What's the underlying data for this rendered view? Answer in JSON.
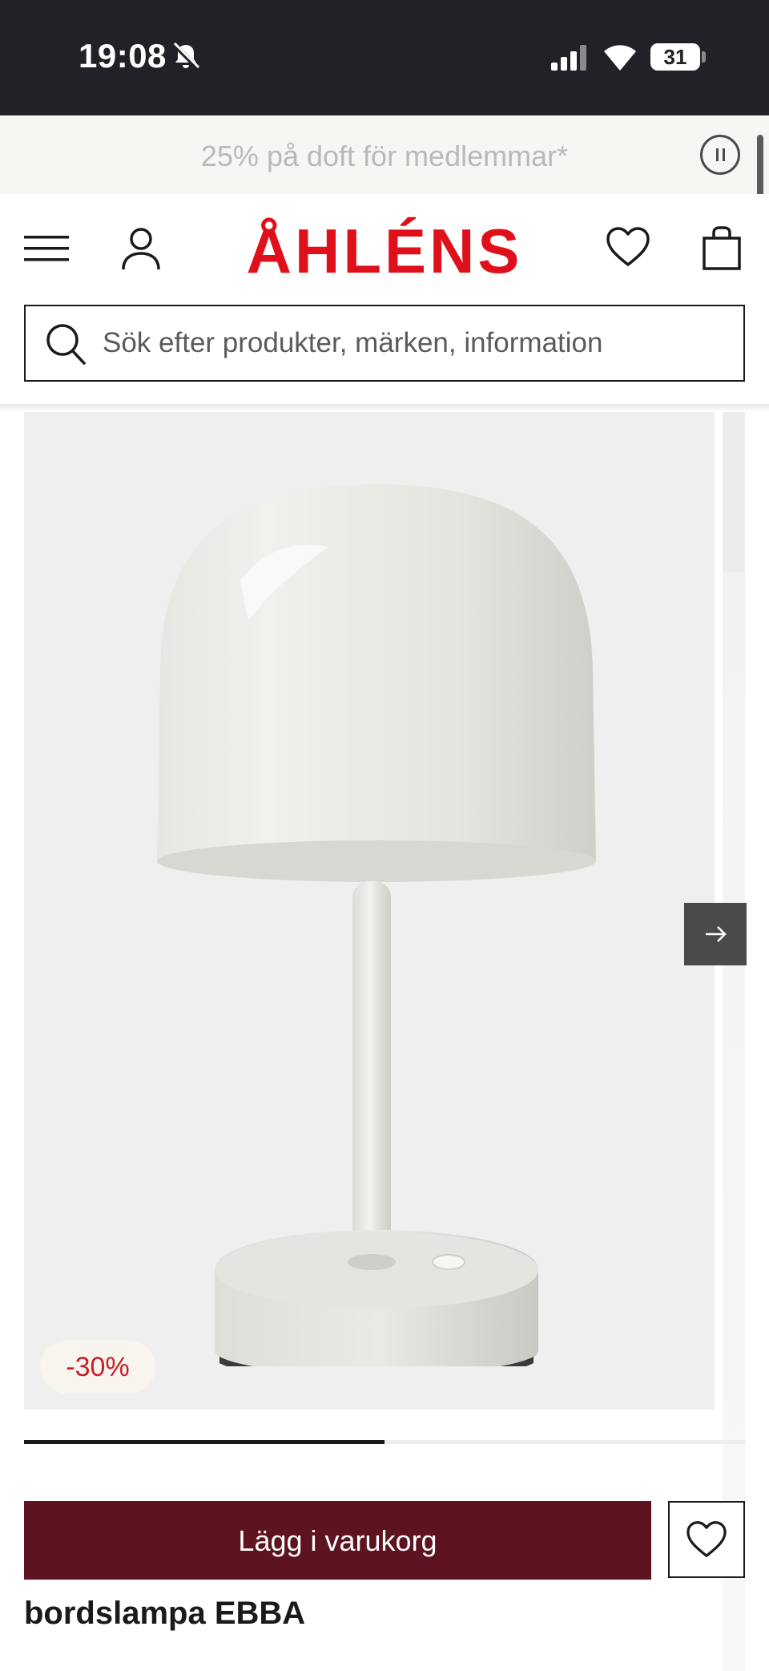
{
  "status_bar": {
    "time": "19:08",
    "battery": "31",
    "icons": [
      "bell-off-icon",
      "signal-icon",
      "wifi-icon",
      "battery-icon"
    ]
  },
  "promo": {
    "text": "25% på doft för medlemmar*"
  },
  "header": {
    "logo": "ÅHLÉNS",
    "icons": [
      "menu-icon",
      "account-icon",
      "heart-icon",
      "bag-icon"
    ],
    "brand_color": "#e0101a"
  },
  "search": {
    "placeholder": "Sök efter produkter, märken, information"
  },
  "gallery": {
    "discount_badge": "-30%",
    "image_progress": 0.5
  },
  "product": {
    "add_to_cart_label": "Lägg i varukorg",
    "title": "bordslampa EBBA",
    "cart_button_color": "#5e1420"
  }
}
